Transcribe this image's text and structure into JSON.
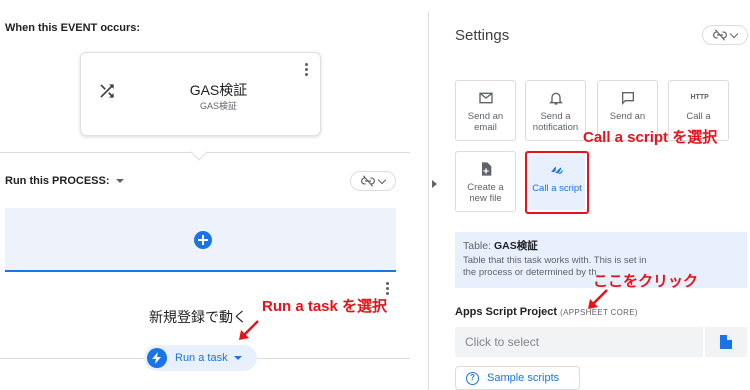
{
  "colors": {
    "accent": "#1a73e8",
    "annotation": "#e8121b",
    "panel_bg": "#e8f0fe"
  },
  "event": {
    "section_label": "When this EVENT occurs:",
    "card_title": "GAS検証",
    "card_subtitle": "GAS検証",
    "icon": "shuffle-icon"
  },
  "process": {
    "section_label": "Run this PROCESS:",
    "task_name": "新規登録で動く",
    "task_type_label": "Run a task",
    "task_icon": "bolt-icon"
  },
  "annotations": {
    "run_task": "Run a task を選択",
    "call_script": "Call a script を選択",
    "click_here": "ここをクリック"
  },
  "settings": {
    "title": "Settings",
    "tiles": [
      {
        "label": "Send an email",
        "icon": "mail-icon"
      },
      {
        "label": "Send a notification",
        "icon": "bell-icon"
      },
      {
        "label": "Send an",
        "icon": "message-icon"
      },
      {
        "label": "Call a",
        "icon": "http-icon",
        "icon_text": "HTTP"
      },
      {
        "label": "Create a new file",
        "icon": "file-icon"
      },
      {
        "label": "Call a script",
        "icon": "apps-script-icon",
        "selected": true
      }
    ],
    "info": {
      "table_label": "Table:",
      "table_name": "GAS検証",
      "description": "Table that this task works with. This is set in the process or determined by th"
    },
    "apps_script": {
      "label": "Apps Script Project",
      "sub_label": "(APPSHEET CORE)",
      "placeholder": "Click to select"
    },
    "sample_button": "Sample scripts"
  }
}
